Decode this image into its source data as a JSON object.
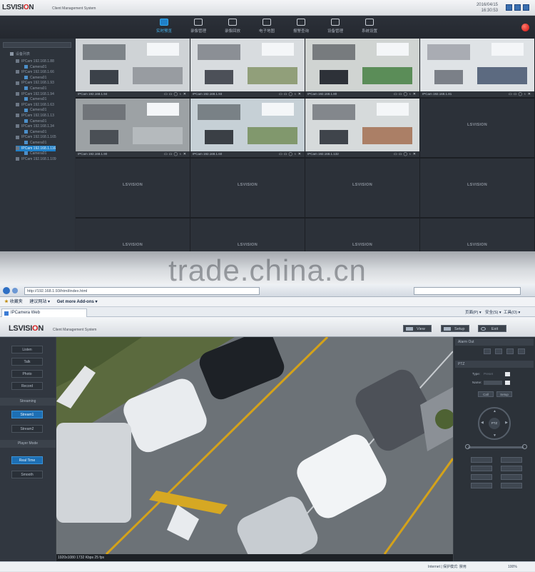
{
  "cms": {
    "brand": {
      "prefix": "LSVISI",
      "accent": "O",
      "suffix": "N"
    },
    "subtitle": "Client Management System",
    "datetime": "2016/04/15\n16:30:53",
    "nav": [
      {
        "label": "实时预览",
        "icon": "monitor-icon",
        "active": true
      },
      {
        "label": "录像管理",
        "icon": "camera-film-icon",
        "active": false
      },
      {
        "label": "录像回放",
        "icon": "playback-icon",
        "active": false
      },
      {
        "label": "电子地图",
        "icon": "map-icon",
        "active": false
      },
      {
        "label": "报警查询",
        "icon": "alarm-icon",
        "active": false
      },
      {
        "label": "设备管理",
        "icon": "device-icon",
        "active": false
      },
      {
        "label": "系统设置",
        "icon": "tools-icon",
        "active": false
      }
    ],
    "tree_root": "设备列表",
    "tree": [
      "IPCam 192.168.1.88",
      "Camera01",
      "IPCam 192.168.1.66",
      "Camera01",
      "IPCam 192.168.1.93",
      "Camera01",
      "IPCam 192.168.1.94",
      "Camera01",
      "IPCam 192.168.1.63",
      "Camera01",
      "IPCam 192.168.1.13",
      "Camera01",
      "IPCam 192.168.1.34",
      "Camera01",
      "IPCam 192.168.1.165",
      "Camera01",
      "IPCam 192.168.1.116",
      "Camera01",
      "IPCam 192.168.1.109"
    ],
    "tree_selected": 16,
    "cams": [
      {
        "label": "IPCam 192.168.1.94"
      },
      {
        "label": "IPCam 192.168.1.93"
      },
      {
        "label": "IPCam 192.168.1.80"
      },
      {
        "label": "IPCam 192.168.1.81"
      },
      {
        "label": "IPCam 192.168.1.90"
      },
      {
        "label": "IPCam 192.168.1.60"
      },
      {
        "label": "IPCam 192.168.1.132"
      }
    ],
    "empty_watermark": "LSVISION"
  },
  "watermark": "trade.china.cn",
  "browser": {
    "url": "http://192.168.1.93/html/index.html",
    "favorites": "收藏夹",
    "fav_items": [
      "建议网站 ▾",
      "Get more Add-ons ▾"
    ],
    "tab_title": "IPCamera Web",
    "tools": [
      "页面(P) ▾",
      "安全(S) ▾",
      "工具(O) ▾"
    ]
  },
  "web": {
    "brand": {
      "prefix": "LSVISI",
      "accent": "O",
      "suffix": "N"
    },
    "subtitle": "Client Management System",
    "views": [
      "View",
      "Setup",
      "Exit"
    ],
    "left_buttons": [
      "Listen",
      "Talk",
      "Photo",
      "Record"
    ],
    "streaming_label": "Streaming",
    "streams": [
      "Stream1",
      "Stream2"
    ],
    "player_label": "Player Mode",
    "modes": [
      "Real Time",
      "Smooth"
    ],
    "status": "1920x1080   1732 Kbps 25 fps",
    "ptz": {
      "alarm_out_label": "Alarm Out",
      "ptz_label": "PTZ",
      "type_label": "Type:",
      "type_value": "Preset",
      "name_label": "Name:",
      "call_label": "Call",
      "setup_label": "Setup",
      "center_label": "PTZ"
    }
  },
  "statusbar": {
    "zone": "Internet | 保护模式: 禁用",
    "zoom": "100%"
  }
}
